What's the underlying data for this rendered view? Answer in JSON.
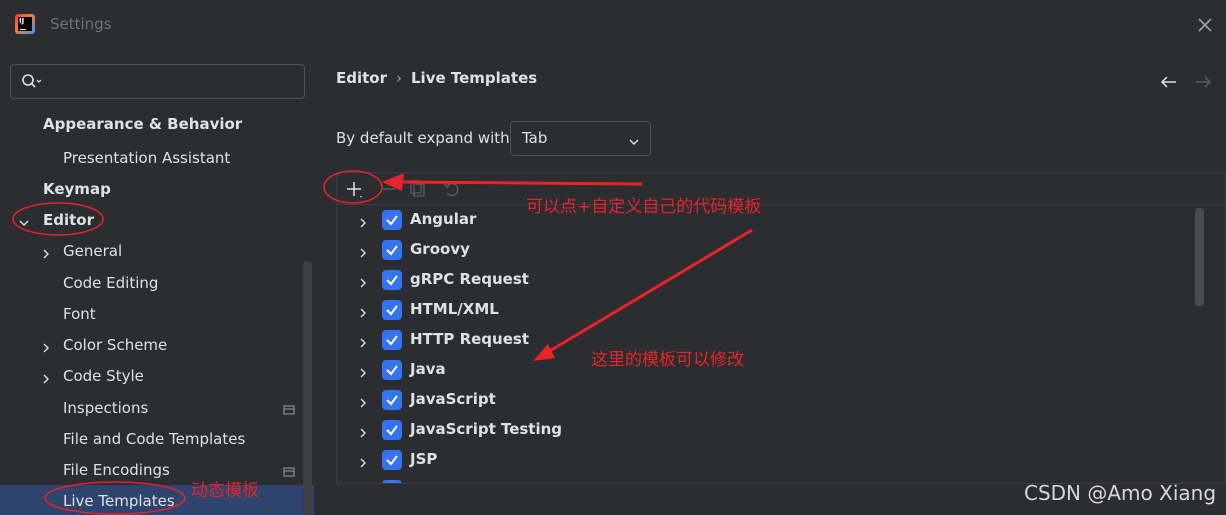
{
  "window": {
    "title": "Settings",
    "logo_text": "IJ"
  },
  "sidebar": {
    "search": {
      "value": "",
      "placeholder": ""
    },
    "items": [
      {
        "label": "Appearance & Behavior"
      },
      {
        "label": "Presentation Assistant"
      },
      {
        "label": "Keymap"
      },
      {
        "label": "Editor"
      },
      {
        "label": "General"
      },
      {
        "label": "Code Editing"
      },
      {
        "label": "Font"
      },
      {
        "label": "Color Scheme"
      },
      {
        "label": "Code Style"
      },
      {
        "label": "Inspections"
      },
      {
        "label": "File and Code Templates"
      },
      {
        "label": "File Encodings"
      },
      {
        "label": "Live Templates"
      }
    ]
  },
  "main": {
    "breadcrumb": {
      "parent": "Editor",
      "separator": "›",
      "current": "Live Templates"
    },
    "expand_with": {
      "label": "By default expand with",
      "value": "Tab"
    },
    "templates": [
      {
        "label": "Angular",
        "checked": true
      },
      {
        "label": "Groovy",
        "checked": true
      },
      {
        "label": "gRPC Request",
        "checked": true
      },
      {
        "label": "HTML/XML",
        "checked": true
      },
      {
        "label": "HTTP Request",
        "checked": true
      },
      {
        "label": "Java",
        "checked": true
      },
      {
        "label": "JavaScript",
        "checked": true
      },
      {
        "label": "JavaScript Testing",
        "checked": true
      },
      {
        "label": "JSP",
        "checked": true
      }
    ]
  },
  "annotations": {
    "add_note": "可以点+自定义自己的代码模板",
    "edit_note": "这里的模板可以修改",
    "live_templates_note": "动态模板"
  },
  "watermark": "CSDN @Amo Xiang",
  "colors": {
    "accent": "#3574f0",
    "annotation": "#e8232a",
    "selection": "#2e436e"
  }
}
